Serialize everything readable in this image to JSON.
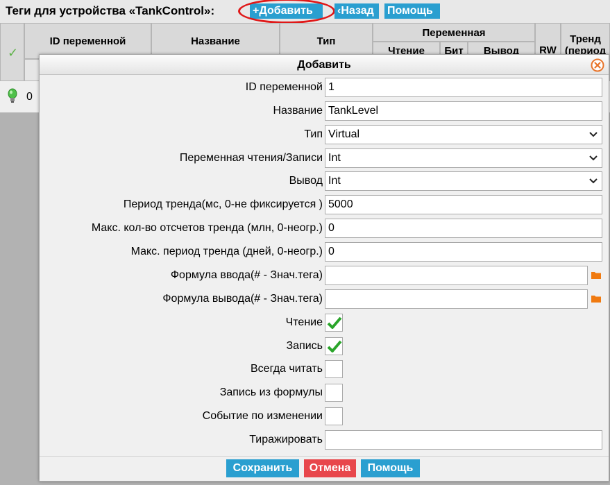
{
  "header": {
    "title": "Теги для устройства «TankControl»:",
    "add_label": "+Добавить",
    "back_label": "‹Назад",
    "help_label": "Помощь"
  },
  "table": {
    "columns": {
      "id": "ID переменной",
      "name": "Название",
      "type": "Тип",
      "variable": "Переменная",
      "read": "Чтение",
      "bit": "Бит",
      "output": "Вывод",
      "rw": "RW",
      "trend": "Тренд (период"
    },
    "rows": [
      {
        "id": "0"
      }
    ]
  },
  "dialog": {
    "title": "Добавить",
    "fields": {
      "var_id": {
        "label": "ID переменной",
        "value": "1"
      },
      "name": {
        "label": "Название",
        "value": "TankLevel"
      },
      "type": {
        "label": "Тип",
        "value": "Virtual"
      },
      "rw_var": {
        "label": "Переменная чтения/Записи",
        "value": "Int"
      },
      "output": {
        "label": "Вывод",
        "value": "Int"
      },
      "trend_period": {
        "label": "Период тренда(мс, 0-не фиксируется )",
        "value": "5000"
      },
      "trend_max_count": {
        "label": "Макс. кол-во отсчетов тренда (млн, 0-неогр.)",
        "value": "0"
      },
      "trend_max_days": {
        "label": "Макс. период тренда (дней, 0-неогр.)",
        "value": "0"
      },
      "input_formula": {
        "label": "Формула ввода(# - Знач.тега)",
        "value": ""
      },
      "output_formula": {
        "label": "Формула вывода(# - Знач.тега)",
        "value": ""
      },
      "read": {
        "label": "Чтение",
        "checked": true
      },
      "write": {
        "label": "Запись",
        "checked": true
      },
      "always_read": {
        "label": "Всегда читать",
        "checked": false
      },
      "write_from_formula": {
        "label": "Запись из формулы",
        "checked": false
      },
      "event_on_change": {
        "label": "Событие по изменении",
        "checked": false
      },
      "replicate": {
        "label": "Тиражировать",
        "value": ""
      }
    },
    "buttons": {
      "save": "Сохранить",
      "cancel": "Отмена",
      "help": "Помощь"
    }
  },
  "colors": {
    "button_blue": "#2a9fd0",
    "button_red": "#e8474c",
    "highlight_ellipse": "#e01818",
    "check_green": "#2aa52a",
    "folder_orange": "#f07a10"
  }
}
